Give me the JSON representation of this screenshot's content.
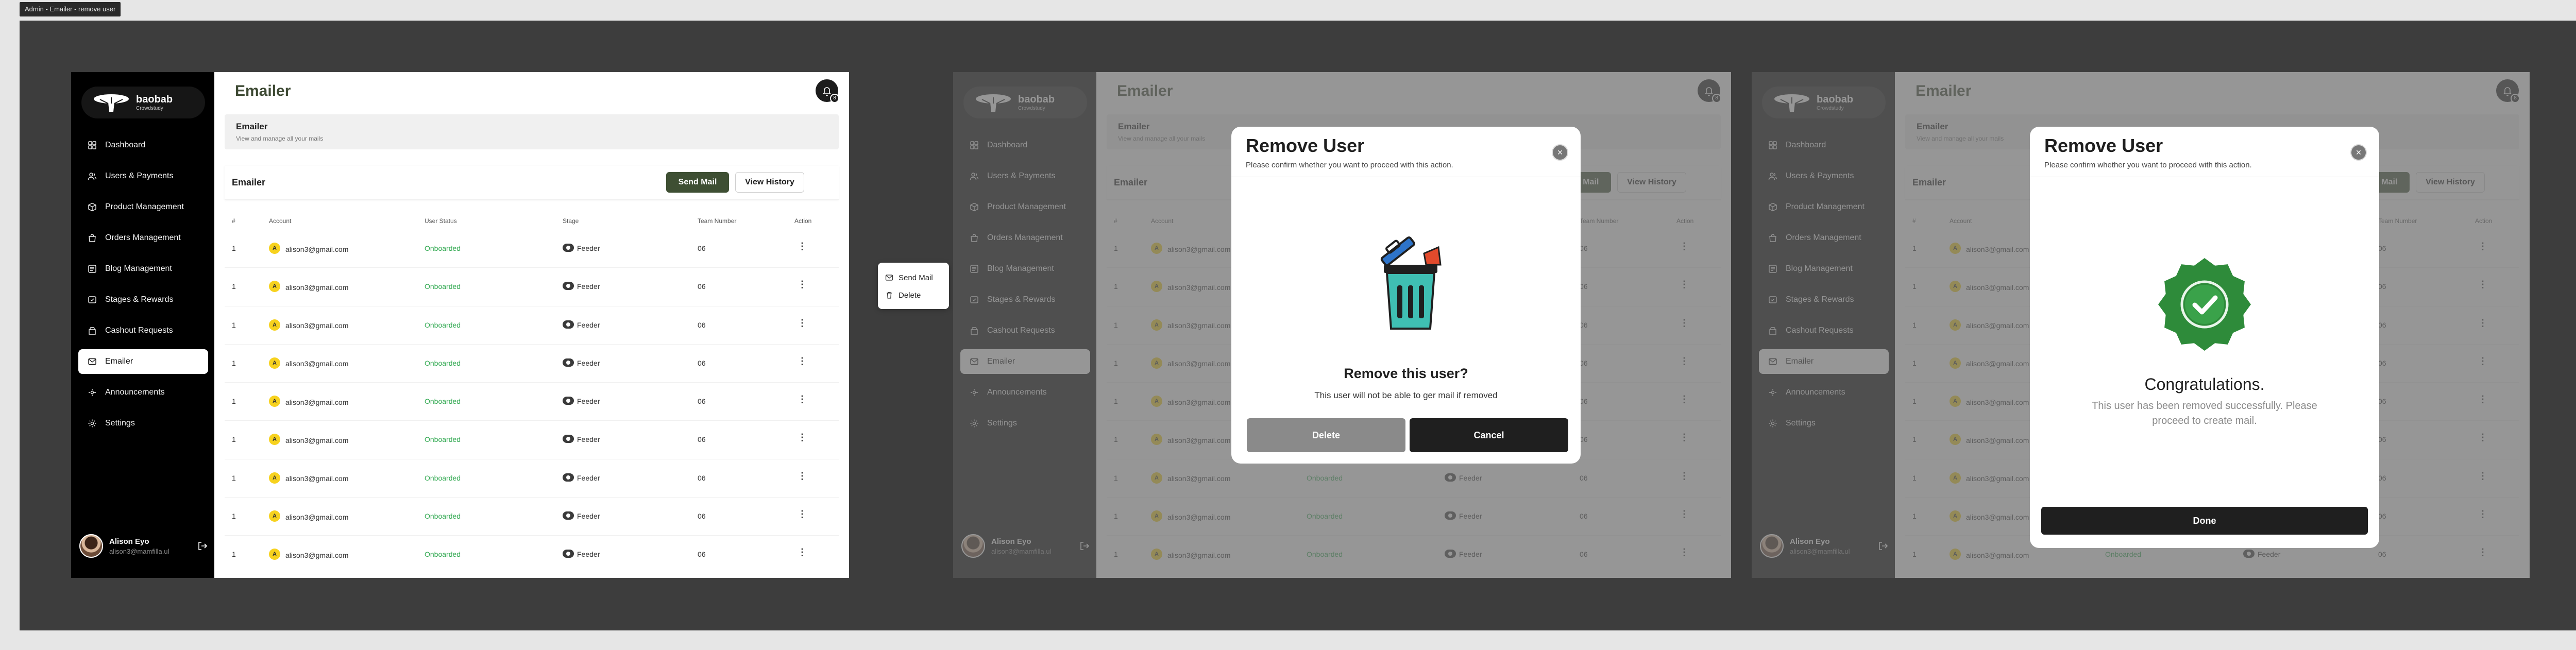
{
  "canvas_label": "Admin - Emailer - remove user",
  "brand": {
    "name": "baobab",
    "tagline": "Crowdstudy"
  },
  "sidebar": {
    "items": [
      {
        "label": "Dashboard",
        "icon": "grid-icon"
      },
      {
        "label": "Users & Payments",
        "icon": "users-icon"
      },
      {
        "label": "Product Management",
        "icon": "box-icon"
      },
      {
        "label": "Orders Management",
        "icon": "bag-icon"
      },
      {
        "label": "Blog Management",
        "icon": "blog-icon"
      },
      {
        "label": "Stages & Rewards",
        "icon": "trophy-icon"
      },
      {
        "label": "Cashout Requests",
        "icon": "wallet-icon"
      },
      {
        "label": "Emailer",
        "icon": "mail-icon",
        "active": true
      },
      {
        "label": "Announcements",
        "icon": "megaphone-icon"
      },
      {
        "label": "Settings",
        "icon": "gear-icon"
      }
    ],
    "profile": {
      "name": "Alison Eyo",
      "email": "alison3@mamfilla.ul"
    }
  },
  "header": {
    "title": "Emailer",
    "notification_count": "8"
  },
  "banner": {
    "title": "Emailer",
    "subtitle": "View and manage all your mails"
  },
  "section": {
    "title": "Emailer",
    "send_label": "Send Mail",
    "history_label": "View History"
  },
  "table": {
    "columns": [
      "#",
      "Account",
      "User Status",
      "Stage",
      "Team Number",
      "Action"
    ],
    "rows": [
      {
        "index": "1",
        "initial": "A",
        "account": "alison3@gmail.com",
        "status": "Onboarded",
        "stage": "Feeder",
        "team": "06"
      },
      {
        "index": "1",
        "initial": "A",
        "account": "alison3@gmail.com",
        "status": "Onboarded",
        "stage": "Feeder",
        "team": "06"
      },
      {
        "index": "1",
        "initial": "A",
        "account": "alison3@gmail.com",
        "status": "Onboarded",
        "stage": "Feeder",
        "team": "06"
      },
      {
        "index": "1",
        "initial": "A",
        "account": "alison3@gmail.com",
        "status": "Onboarded",
        "stage": "Feeder",
        "team": "06"
      },
      {
        "index": "1",
        "initial": "A",
        "account": "alison3@gmail.com",
        "status": "Onboarded",
        "stage": "Feeder",
        "team": "06"
      },
      {
        "index": "1",
        "initial": "A",
        "account": "alison3@gmail.com",
        "status": "Onboarded",
        "stage": "Feeder",
        "team": "06"
      },
      {
        "index": "1",
        "initial": "A",
        "account": "alison3@gmail.com",
        "status": "Onboarded",
        "stage": "Feeder",
        "team": "06"
      },
      {
        "index": "1",
        "initial": "A",
        "account": "alison3@gmail.com",
        "status": "Onboarded",
        "stage": "Feeder",
        "team": "06"
      },
      {
        "index": "1",
        "initial": "A",
        "account": "alison3@gmail.com",
        "status": "Onboarded",
        "stage": "Feeder",
        "team": "06"
      }
    ]
  },
  "action_menu": {
    "send_label": "Send Mail",
    "delete_label": "Delete"
  },
  "remove_modal": {
    "title": "Remove User",
    "subtitle": "Please confirm whether you want to proceed with this action.",
    "confirm_title": "Remove this user?",
    "confirm_text": "This user will not be able to ger mail if removed",
    "delete_label": "Delete",
    "cancel_label": "Cancel"
  },
  "success_modal": {
    "title": "Remove User",
    "subtitle": "Please confirm whether you want to proceed with this action.",
    "heading": "Congratulations.",
    "message": "This user has been removed successfully. Please proceed to create mail.",
    "done_label": "Done"
  },
  "colors": {
    "accent": "#3e4f33",
    "status_green": "#2fa84f",
    "sidebar_bg": "#000000",
    "badge_green": "#2e8b3a"
  }
}
